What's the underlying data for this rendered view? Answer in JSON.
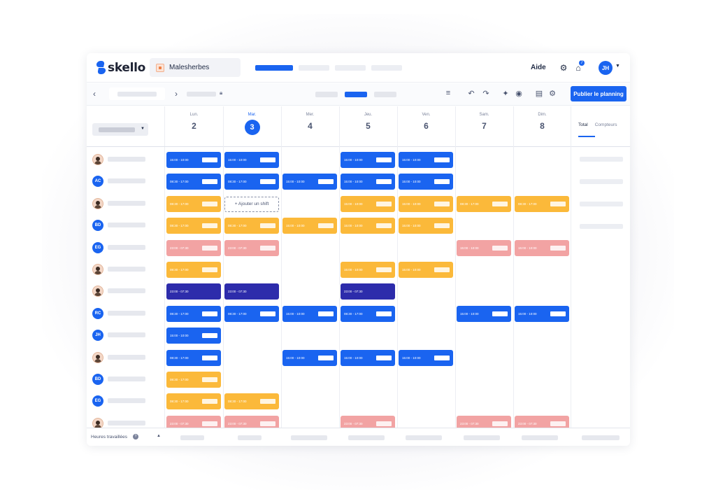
{
  "brand": {
    "name": "skello"
  },
  "header": {
    "shop_name": "Malesherbes",
    "help_label": "Aide",
    "user_initials": "JH",
    "notification_count": "7"
  },
  "toolbar": {
    "publish_label": "Publier le planning"
  },
  "days": [
    {
      "name": "Lun.",
      "num": "2"
    },
    {
      "name": "Mar.",
      "num": "3"
    },
    {
      "name": "Mer.",
      "num": "4"
    },
    {
      "name": "Jeu.",
      "num": "5"
    },
    {
      "name": "Ven.",
      "num": "6"
    },
    {
      "name": "Sam.",
      "num": "7"
    },
    {
      "name": "Dim.",
      "num": "8"
    }
  ],
  "employees": [
    {
      "kind": "photo",
      "initials": ""
    },
    {
      "kind": "initials",
      "initials": "AC"
    },
    {
      "kind": "photo",
      "initials": ""
    },
    {
      "kind": "initials",
      "initials": "BD"
    },
    {
      "kind": "initials",
      "initials": "EG"
    },
    {
      "kind": "photo",
      "initials": ""
    },
    {
      "kind": "photo",
      "initials": ""
    },
    {
      "kind": "initials",
      "initials": "RC"
    },
    {
      "kind": "initials",
      "initials": "JH"
    },
    {
      "kind": "photo",
      "initials": ""
    },
    {
      "kind": "initials",
      "initials": "BD"
    },
    {
      "kind": "initials",
      "initials": "EG"
    },
    {
      "kind": "photo",
      "initials": ""
    }
  ],
  "shifts": [
    {
      "row": 0,
      "day": 0,
      "color": "blue",
      "time": "15:00 - 10:00"
    },
    {
      "row": 0,
      "day": 1,
      "color": "blue",
      "time": "15:00 - 10:00"
    },
    {
      "row": 0,
      "day": 3,
      "color": "blue",
      "time": "15:00 - 10:00"
    },
    {
      "row": 0,
      "day": 4,
      "color": "blue",
      "time": "15:00 - 10:00"
    },
    {
      "row": 1,
      "day": 0,
      "color": "blue",
      "time": "08:30 - 17:00"
    },
    {
      "row": 1,
      "day": 1,
      "color": "blue",
      "time": "08:30 - 17:00"
    },
    {
      "row": 1,
      "day": 2,
      "color": "blue",
      "time": "15:00 - 10:00"
    },
    {
      "row": 1,
      "day": 3,
      "color": "blue",
      "time": "15:00 - 10:00"
    },
    {
      "row": 1,
      "day": 4,
      "color": "blue",
      "time": "15:00 - 10:00"
    },
    {
      "row": 2,
      "day": 0,
      "color": "yellow",
      "time": "08:30 - 17:00"
    },
    {
      "row": 2,
      "day": 3,
      "color": "yellow",
      "time": "15:00 - 10:00"
    },
    {
      "row": 2,
      "day": 4,
      "color": "yellow",
      "time": "15:00 - 10:00"
    },
    {
      "row": 2,
      "day": 5,
      "color": "yellow",
      "time": "08:30 - 17:00"
    },
    {
      "row": 2,
      "day": 6,
      "color": "yellow",
      "time": "08:30 - 17:00"
    },
    {
      "row": 3,
      "day": 0,
      "color": "yellow",
      "time": "08:30 - 17:00"
    },
    {
      "row": 3,
      "day": 1,
      "color": "yellow",
      "time": "08:30 - 17:00"
    },
    {
      "row": 3,
      "day": 2,
      "color": "yellow",
      "time": "15:00 - 10:00"
    },
    {
      "row": 3,
      "day": 3,
      "color": "yellow",
      "time": "15:00 - 10:00"
    },
    {
      "row": 3,
      "day": 4,
      "color": "yellow",
      "time": "15:00 - 10:00"
    },
    {
      "row": 4,
      "day": 0,
      "color": "pink",
      "time": "23:00 - 07:30"
    },
    {
      "row": 4,
      "day": 1,
      "color": "pink",
      "time": "23:00 - 07:30"
    },
    {
      "row": 4,
      "day": 5,
      "color": "pink",
      "time": "15:00 - 10:00"
    },
    {
      "row": 4,
      "day": 6,
      "color": "pink",
      "time": "15:00 - 10:00"
    },
    {
      "row": 5,
      "day": 0,
      "color": "yellow",
      "time": "08:30 - 17:00"
    },
    {
      "row": 5,
      "day": 3,
      "color": "yellow",
      "time": "15:00 - 10:00"
    },
    {
      "row": 5,
      "day": 4,
      "color": "yellow",
      "time": "15:00 - 10:00"
    },
    {
      "row": 6,
      "day": 0,
      "color": "navy",
      "time": "23:00 - 07:30"
    },
    {
      "row": 6,
      "day": 1,
      "color": "navy",
      "time": "23:00 - 07:30"
    },
    {
      "row": 6,
      "day": 3,
      "color": "navy",
      "time": "23:00 - 07:30"
    },
    {
      "row": 7,
      "day": 0,
      "color": "blue",
      "time": "08:30 - 17:00"
    },
    {
      "row": 7,
      "day": 1,
      "color": "blue",
      "time": "08:30 - 17:00"
    },
    {
      "row": 7,
      "day": 2,
      "color": "blue",
      "time": "15:00 - 10:00"
    },
    {
      "row": 7,
      "day": 3,
      "color": "blue",
      "time": "08:30 - 17:00"
    },
    {
      "row": 7,
      "day": 5,
      "color": "blue",
      "time": "15:00 - 10:00"
    },
    {
      "row": 7,
      "day": 6,
      "color": "blue",
      "time": "15:00 - 10:00"
    },
    {
      "row": 8,
      "day": 0,
      "color": "blue",
      "time": "15:00 - 10:00"
    },
    {
      "row": 9,
      "day": 0,
      "color": "blue",
      "time": "08:30 - 17:00"
    },
    {
      "row": 9,
      "day": 2,
      "color": "blue",
      "time": "15:00 - 10:00"
    },
    {
      "row": 9,
      "day": 3,
      "color": "blue",
      "time": "15:00 - 10:00"
    },
    {
      "row": 9,
      "day": 4,
      "color": "blue",
      "time": "15:00 - 10:00"
    },
    {
      "row": 10,
      "day": 0,
      "color": "yellow",
      "time": "08:30 - 17:00"
    },
    {
      "row": 11,
      "day": 0,
      "color": "yellow",
      "time": "08:30 - 17:00"
    },
    {
      "row": 11,
      "day": 1,
      "color": "yellow",
      "time": "08:30 - 17:00"
    },
    {
      "row": 12,
      "day": 0,
      "color": "pink",
      "time": "23:00 - 07:30"
    },
    {
      "row": 12,
      "day": 1,
      "color": "pink",
      "time": "23:00 - 07:30"
    },
    {
      "row": 12,
      "day": 3,
      "color": "pink",
      "time": "23:00 - 07:30"
    },
    {
      "row": 12,
      "day": 5,
      "color": "pink",
      "time": "23:00 - 07:30"
    },
    {
      "row": 12,
      "day": 6,
      "color": "pink",
      "time": "23:00 - 07:30"
    }
  ],
  "add_shift_label": "+ Ajouter un shift",
  "right_panel": {
    "tab_total": "Total",
    "tab_counters": "Compteurs"
  },
  "footer": {
    "hours_label": "Heures travaillées",
    "help_icon": "?"
  },
  "colors": {
    "primary": "#1a64f0",
    "yellow": "#fbb93a",
    "pink": "#f2a3a3",
    "navy": "#2d2cab"
  }
}
